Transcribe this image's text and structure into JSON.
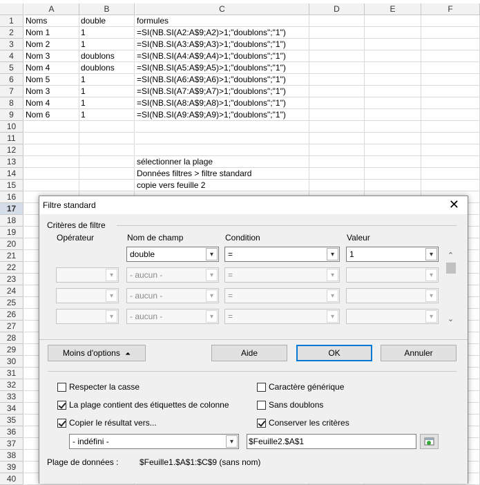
{
  "columns": [
    "A",
    "B",
    "C",
    "D",
    "E",
    "F"
  ],
  "rows": [
    "1",
    "2",
    "3",
    "4",
    "5",
    "6",
    "7",
    "8",
    "9",
    "10",
    "11",
    "12",
    "13",
    "14",
    "15",
    "16",
    "17",
    "18",
    "19",
    "20",
    "21",
    "22",
    "23",
    "24",
    "25",
    "26",
    "27",
    "28",
    "29",
    "30",
    "31",
    "32",
    "33",
    "34",
    "35",
    "36",
    "37",
    "38",
    "39",
    "40"
  ],
  "selected_row": "17",
  "cells": {
    "A": [
      "Noms",
      "Nom 1",
      "Nom 2",
      "Nom 3",
      "Nom 4",
      "Nom 5",
      "Nom 3",
      "Nom 4",
      "Nom 6"
    ],
    "B": [
      "double",
      "1",
      "1",
      "doublons",
      "doublons",
      "1",
      "1",
      "1",
      "1"
    ],
    "C": [
      "formules",
      "=SI(NB.SI(A2:A$9;A2)>1;\"doublons\";\"1\")",
      "=SI(NB.SI(A3:A$9;A3)>1;\"doublons\";\"1\")",
      "=SI(NB.SI(A4:A$9;A4)>1;\"doublons\";\"1\")",
      "=SI(NB.SI(A5:A$9;A5)>1;\"doublons\";\"1\")",
      "=SI(NB.SI(A6:A$9;A6)>1;\"doublons\";\"1\")",
      "=SI(NB.SI(A7:A$9;A7)>1;\"doublons\";\"1\")",
      "=SI(NB.SI(A8:A$9;A8)>1;\"doublons\";\"1\")",
      "=SI(NB.SI(A9:A$9;A9)>1;\"doublons\";\"1\")"
    ],
    "notes": [
      "sélectionner la plage",
      "Données filtres > filtre standard",
      "copie vers feuille 2"
    ]
  },
  "dialog": {
    "title": "Filtre standard",
    "criteria_label": "Critères de filtre",
    "col_operator": "Opérateur",
    "col_field": "Nom de champ",
    "col_condition": "Condition",
    "col_value": "Valeur",
    "row1": {
      "field": "double",
      "condition": "=",
      "value": "1"
    },
    "row_empty": {
      "operator": "",
      "field": "- aucun -",
      "condition": "=",
      "value": ""
    },
    "btn_options": "Moins d'options",
    "btn_help": "Aide",
    "btn_ok": "OK",
    "btn_cancel": "Annuler",
    "opt_case": "Respecter la casse",
    "opt_headers": "La plage contient des étiquettes de colonne",
    "opt_copy": "Copier le résultat vers...",
    "opt_wildcard": "Caractère générique",
    "opt_nodup": "Sans doublons",
    "opt_keep": "Conserver les critères",
    "checks": {
      "case": false,
      "headers": true,
      "copy": true,
      "wildcard": false,
      "nodup": false,
      "keep": true
    },
    "copy_target_select": "- indéfini -",
    "copy_target_ref": "$Feuille2.$A$1",
    "range_label": "Plage de données :",
    "range_value": "$Feuille1.$A$1:$C$9 (sans nom)"
  }
}
